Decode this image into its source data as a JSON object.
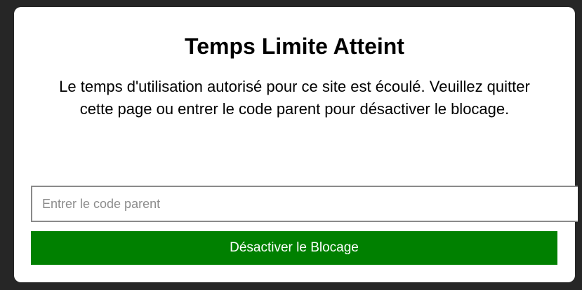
{
  "modal": {
    "title": "Temps Limite Atteint",
    "message": "Le temps d'utilisation autorisé pour ce site est écoulé. Veuillez quitter cette page ou entrer le code parent pour désactiver le blocage.",
    "input": {
      "value": "",
      "placeholder": "Entrer le code parent"
    },
    "button_label": "Désactiver le Blocage"
  },
  "colors": {
    "background": "#262626",
    "modal": "#ffffff",
    "button": "#008000",
    "button_text": "#ffffff"
  }
}
